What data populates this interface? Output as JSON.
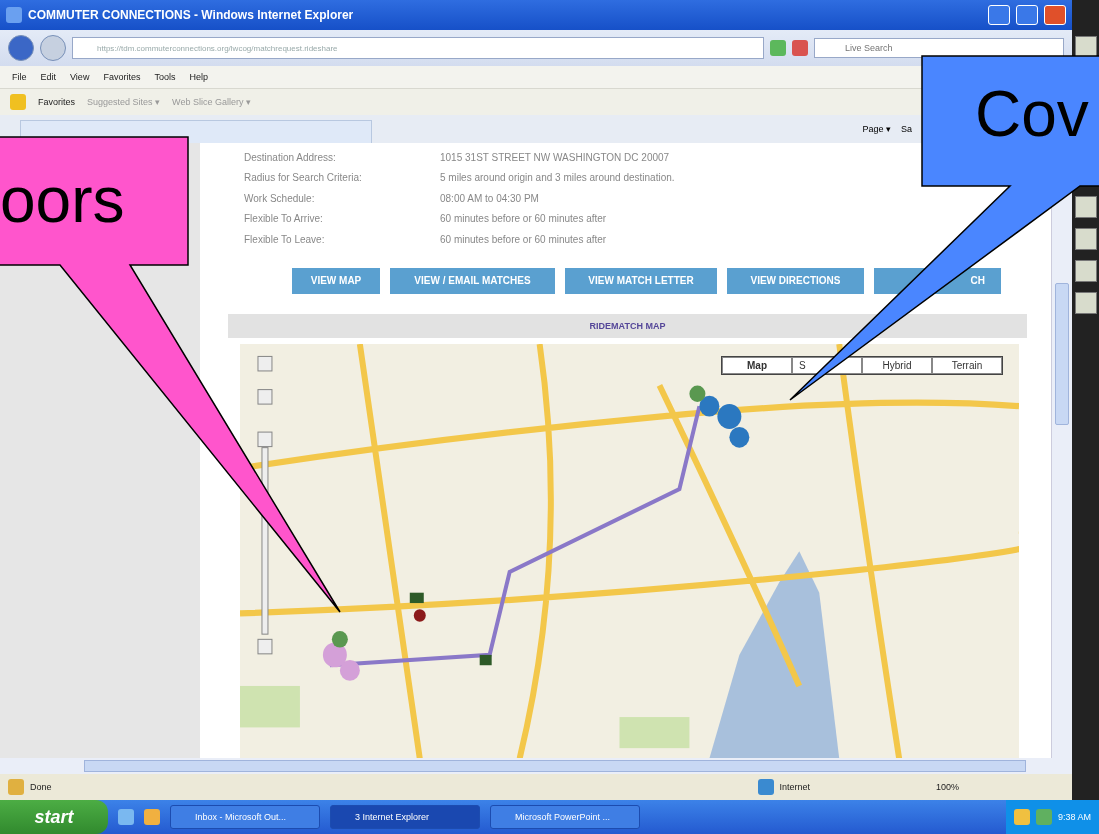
{
  "window": {
    "title": "COMMUTER CONNECTIONS - Windows Internet Explorer"
  },
  "address_bar": {
    "url": "https://tdm.commuterconnections.org/lwcog/matchrequest.rideshare",
    "search_placeholder": "Live Search"
  },
  "menu": [
    "File",
    "Edit",
    "View",
    "Favorites",
    "Tools",
    "Help"
  ],
  "favorites_bar": {
    "label": "Favorites",
    "links": [
      "Suggested Sites ▾",
      "Web Slice Gallery ▾"
    ]
  },
  "command_bar": {
    "page": "Page ▾",
    "safety": "Sa"
  },
  "details": [
    {
      "label": "Destination Address:",
      "value": "1015 31ST STREET NW WASHINGTON DC 20007"
    },
    {
      "label": "Radius for Search Criteria:",
      "value": "5 miles around origin and 3 miles around destination."
    },
    {
      "label": "Work Schedule:",
      "value": "08:00 AM to 04:30 PM"
    },
    {
      "label": "Flexible To Arrive:",
      "value": "60 minutes before or 60 minutes after"
    },
    {
      "label": "Flexible To Leave:",
      "value": "60 minutes before or 60 minutes after"
    }
  ],
  "buttons": [
    "VIEW MAP",
    "VIEW / EMAIL MATCHES",
    "VIEW MATCH LETTER",
    "VIEW DIRECTIONS",
    "CH"
  ],
  "map_section": {
    "title": "RIDEMATCH MAP",
    "map_types": [
      {
        "label": "Map",
        "selected": true
      },
      {
        "label": "S",
        "selected": false
      },
      {
        "label": "Hybrid",
        "selected": false
      },
      {
        "label": "Terrain",
        "selected": false
      }
    ]
  },
  "status_bar": {
    "status": "Done",
    "zone": "Internet",
    "zoom": "100%"
  },
  "taskbar": {
    "start": "start",
    "tasks": [
      "Inbox - Microsoft Out...",
      "3 Internet Explorer",
      "Microsoft PowerPoint ..."
    ],
    "clock": "9:38 AM"
  },
  "callouts": [
    {
      "text": "oors",
      "color": "#ff55cc"
    },
    {
      "text": "Cov",
      "color": "#4a86ff"
    }
  ]
}
